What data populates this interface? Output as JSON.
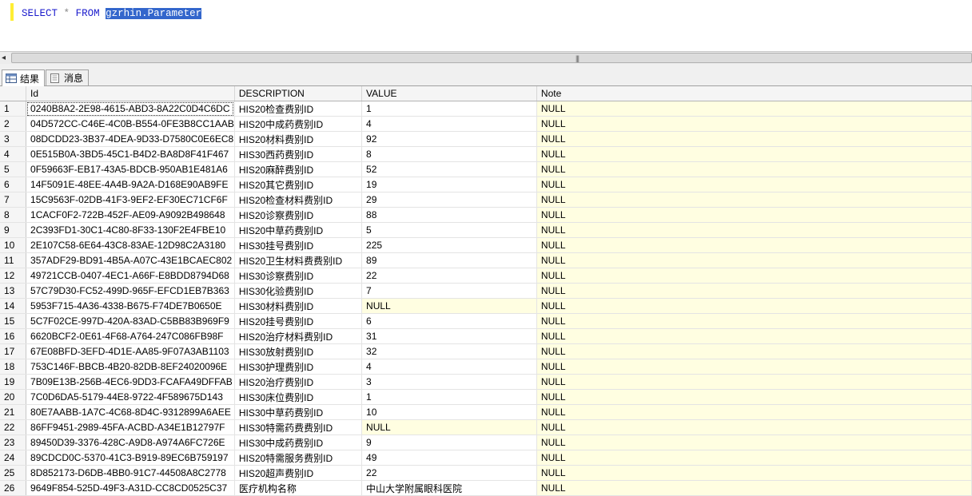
{
  "editor": {
    "kw_select": "SELECT",
    "op_star": "*",
    "kw_from": "FROM",
    "table_name": "gzrhin.Parameter"
  },
  "scrollbar": {
    "grip": "|||"
  },
  "tabs": [
    {
      "label": "结果"
    },
    {
      "label": "消息"
    }
  ],
  "grid": {
    "columns": [
      "Id",
      "DESCRIPTION",
      "VALUE",
      "Note"
    ],
    "rows": [
      {
        "n": "1",
        "id": "0240B8A2-2E98-4615-ABD3-8A22C0D4C6DC",
        "desc": "HIS20检查费别ID",
        "value": "1",
        "note": "NULL"
      },
      {
        "n": "2",
        "id": "04D572CC-C46E-4C0B-B554-0FE3B8CC1AAB",
        "desc": "HIS20中成药费别ID",
        "value": "4",
        "note": "NULL"
      },
      {
        "n": "3",
        "id": "08DCDD23-3B37-4DEA-9D33-D7580C0E6EC8",
        "desc": "HIS20材料费别ID",
        "value": "92",
        "note": "NULL"
      },
      {
        "n": "4",
        "id": "0E515B0A-3BD5-45C1-B4D2-BA8D8F41F467",
        "desc": "HIS30西药费别ID",
        "value": "8",
        "note": "NULL"
      },
      {
        "n": "5",
        "id": "0F59663F-EB17-43A5-BDCB-950AB1E481A6",
        "desc": "HIS20麻醉费别ID",
        "value": "52",
        "note": "NULL"
      },
      {
        "n": "6",
        "id": "14F5091E-48EE-4A4B-9A2A-D168E90AB9FE",
        "desc": "HIS20其它费别ID",
        "value": "19",
        "note": "NULL"
      },
      {
        "n": "7",
        "id": "15C9563F-02DB-41F3-9EF2-EF30EC71CF6F",
        "desc": "HIS20检查材料费别ID",
        "value": "29",
        "note": "NULL"
      },
      {
        "n": "8",
        "id": "1CACF0F2-722B-452F-AE09-A9092B498648",
        "desc": "HIS20诊察费别ID",
        "value": "88",
        "note": "NULL"
      },
      {
        "n": "9",
        "id": "2C393FD1-30C1-4C80-8F33-130F2E4FBE10",
        "desc": "HIS20中草药费别ID",
        "value": "5",
        "note": "NULL"
      },
      {
        "n": "10",
        "id": "2E107C58-6E64-43C8-83AE-12D98C2A3180",
        "desc": "HIS30挂号费别ID",
        "value": "225",
        "note": "NULL"
      },
      {
        "n": "11",
        "id": "357ADF29-BD91-4B5A-A07C-43E1BCAEC802",
        "desc": "HIS20卫生材料费费别ID",
        "value": "89",
        "note": "NULL"
      },
      {
        "n": "12",
        "id": "49721CCB-0407-4EC1-A66F-E8BDD8794D68",
        "desc": "HIS30诊察费别ID",
        "value": "22",
        "note": "NULL"
      },
      {
        "n": "13",
        "id": "57C79D30-FC52-499D-965F-EFCD1EB7B363",
        "desc": "HIS30化验费别ID",
        "value": "7",
        "note": "NULL"
      },
      {
        "n": "14",
        "id": "5953F715-4A36-4338-B675-F74DE7B0650E",
        "desc": "HIS30材料费别ID",
        "value": "NULL",
        "note": "NULL"
      },
      {
        "n": "15",
        "id": "5C7F02CE-997D-420A-83AD-C5BB83B969F9",
        "desc": "HIS20挂号费别ID",
        "value": "6",
        "note": "NULL"
      },
      {
        "n": "16",
        "id": "6620BCF2-0E61-4F68-A764-247C086FB98F",
        "desc": "HIS20治疗材料费别ID",
        "value": "31",
        "note": "NULL"
      },
      {
        "n": "17",
        "id": "67E08BFD-3EFD-4D1E-AA85-9F07A3AB1103",
        "desc": "HIS30放射费别ID",
        "value": "32",
        "note": "NULL"
      },
      {
        "n": "18",
        "id": "753C146F-BBCB-4B20-82DB-8EF24020096E",
        "desc": "HIS30护理费别ID",
        "value": "4",
        "note": "NULL"
      },
      {
        "n": "19",
        "id": "7B09E13B-256B-4EC6-9DD3-FCAFA49DFFAB",
        "desc": "HIS20治疗费别ID",
        "value": "3",
        "note": "NULL"
      },
      {
        "n": "20",
        "id": "7C0D6DA5-5179-44E8-9722-4F589675D143",
        "desc": "HIS30床位费别ID",
        "value": "1",
        "note": "NULL"
      },
      {
        "n": "21",
        "id": "80E7AABB-1A7C-4C68-8D4C-9312899A6AEE",
        "desc": "HIS30中草药费别ID",
        "value": "10",
        "note": "NULL"
      },
      {
        "n": "22",
        "id": "86FF9451-2989-45FA-ACBD-A34E1B12797F",
        "desc": "HIS30特需药费费别ID",
        "value": "NULL",
        "note": "NULL"
      },
      {
        "n": "23",
        "id": "89450D39-3376-428C-A9D8-A974A6FC726E",
        "desc": "HIS30中成药费别ID",
        "value": "9",
        "note": "NULL"
      },
      {
        "n": "24",
        "id": "89CDCD0C-5370-41C3-B919-89EC6B759197",
        "desc": "HIS20特需服务费别ID",
        "value": "49",
        "note": "NULL"
      },
      {
        "n": "25",
        "id": "8D852173-D6DB-4BB0-91C7-44508A8C2778",
        "desc": "HIS20超声费别ID",
        "value": "22",
        "note": "NULL"
      },
      {
        "n": "26",
        "id": "9649F854-525D-49F3-A31D-CC8CD0525C37",
        "desc": "医疗机构名称",
        "value": "中山大学附属眼科医院",
        "note": "NULL"
      }
    ]
  }
}
